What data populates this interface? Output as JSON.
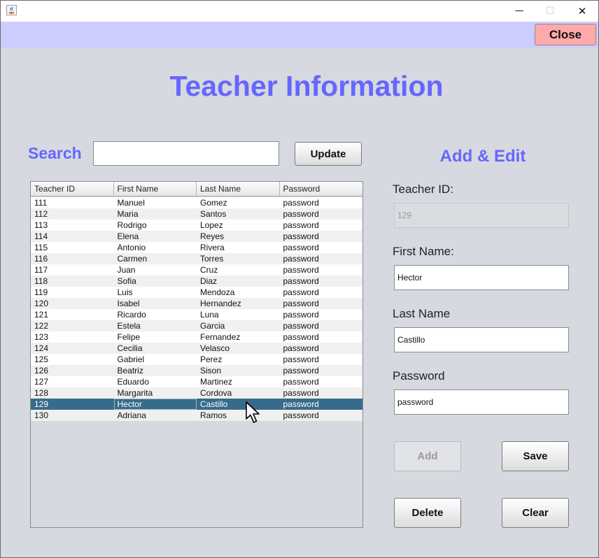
{
  "window": {
    "minimize_glyph": "—",
    "maximize_glyph": "☐",
    "close_glyph": "✕"
  },
  "colors": {
    "accent": "#6666ff",
    "top_band": "#ccccff",
    "close_button": "#ffaaaa",
    "panel_background": "#d6d9df",
    "selected_row": "#376b8b"
  },
  "header": {
    "close_label": "Close"
  },
  "page": {
    "title": "Teacher Information"
  },
  "search": {
    "label": "Search",
    "value": "",
    "update_label": "Update"
  },
  "table": {
    "columns": [
      "Teacher ID",
      "First Name",
      "Last Name",
      "Password"
    ],
    "rows": [
      [
        "111",
        "Manuel",
        "Gomez",
        "password"
      ],
      [
        "112",
        "Maria",
        "Santos",
        "password"
      ],
      [
        "113",
        "Rodrigo",
        "Lopez",
        "password"
      ],
      [
        "114",
        "Elena",
        "Reyes",
        "password"
      ],
      [
        "115",
        "Antonio",
        "Rivera",
        "password"
      ],
      [
        "116",
        "Carmen",
        "Torres",
        "password"
      ],
      [
        "117",
        "Juan",
        "Cruz",
        "password"
      ],
      [
        "118",
        "Sofia",
        "Diaz",
        "password"
      ],
      [
        "119",
        "Luis",
        "Mendoza",
        "password"
      ],
      [
        "120",
        "Isabel",
        "Hernandez",
        "password"
      ],
      [
        "121",
        "Ricardo",
        "Luna",
        "password"
      ],
      [
        "122",
        "Estela",
        "Garcia",
        "password"
      ],
      [
        "123",
        "Felipe",
        "Fernandez",
        "password"
      ],
      [
        "124",
        "Cecilia",
        "Velasco",
        "password"
      ],
      [
        "125",
        "Gabriel",
        "Perez",
        "password"
      ],
      [
        "126",
        "Beatriz",
        "Sison",
        "password"
      ],
      [
        "127",
        "Eduardo",
        "Martinez",
        "password"
      ],
      [
        "128",
        "Margarita",
        "Cordova",
        "password"
      ],
      [
        "129",
        "Hector",
        "Castillo",
        "password"
      ],
      [
        "130",
        "Adriana",
        "Ramos",
        "password"
      ]
    ],
    "selected_row": 18,
    "focused_column": 1
  },
  "form": {
    "heading": "Add & Edit",
    "teacher_id": {
      "label": "Teacher ID:",
      "value": "129"
    },
    "first_name": {
      "label": "First Name:",
      "value": "Hector"
    },
    "last_name": {
      "label": "Last Name",
      "value": "Castillo"
    },
    "password": {
      "label": "Password",
      "value": "password"
    },
    "add_label": "Add",
    "save_label": "Save",
    "delete_label": "Delete",
    "clear_label": "Clear"
  }
}
